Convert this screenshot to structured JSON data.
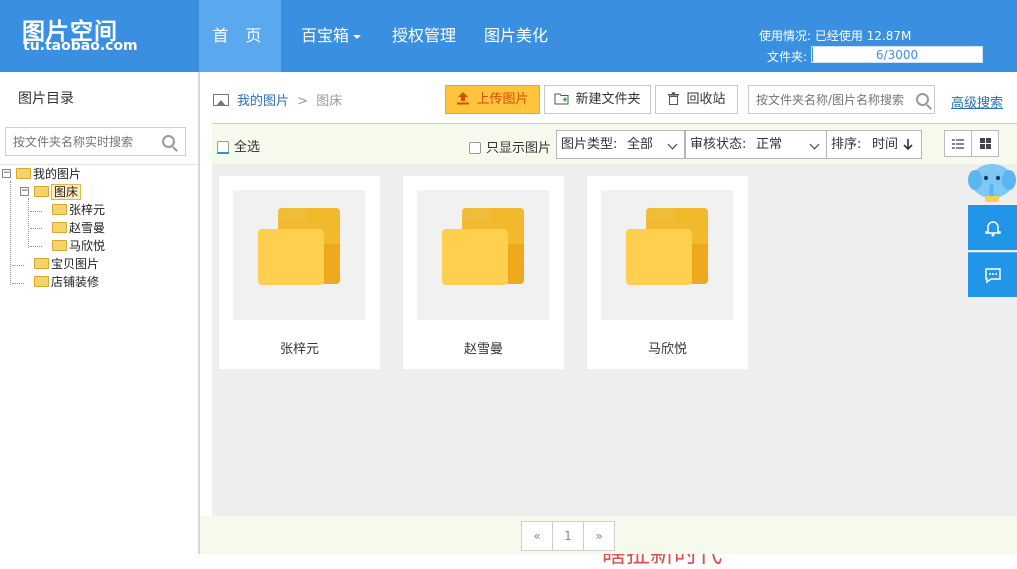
{
  "header": {
    "logo_title": "图片空间",
    "logo_sub": "tu.taobao.com",
    "nav": [
      {
        "label": "首 页"
      },
      {
        "label": "百宝箱"
      },
      {
        "label": "授权管理"
      },
      {
        "label": "图片美化"
      }
    ],
    "usage_text": "使用情况: 已经使用 12.87M",
    "folders_label": "文件夹:",
    "folders_count": "6/3000",
    "folders_used": 6,
    "folders_max": 3000,
    "accent_color": "#3b8fe0"
  },
  "sidebar": {
    "title": "图片目录",
    "search_placeholder": "按文件夹名称实时搜索",
    "tree": {
      "root": "我的图片",
      "selected": "图床",
      "children_of_selected": [
        "张梓元",
        "赵雪曼",
        "马欣悦"
      ],
      "others": [
        "宝贝图片",
        "店铺装修"
      ]
    }
  },
  "main": {
    "breadcrumb": {
      "root": "我的图片",
      "sep": ">",
      "current": "图床"
    },
    "toolbar": {
      "upload": "上传图片",
      "new_folder": "新建文件夹",
      "recycle": "回收站",
      "search_placeholder": "按文件夹名称/图片名称搜索",
      "advanced": "高级搜索"
    },
    "filter": {
      "select_all": "全选",
      "only_images": "只显示图片",
      "type_label": "图片类型:",
      "type_value": "全部",
      "review_label": "审核状态:",
      "review_value": "正常",
      "sort_label": "排序:",
      "sort_value": "时间"
    },
    "folders": [
      {
        "name": "张梓元"
      },
      {
        "name": "赵雪曼"
      },
      {
        "name": "马欣悦"
      }
    ],
    "watermark": "瞎扯新时代",
    "pager": {
      "prev": "«",
      "page": "1",
      "next": "»"
    }
  }
}
